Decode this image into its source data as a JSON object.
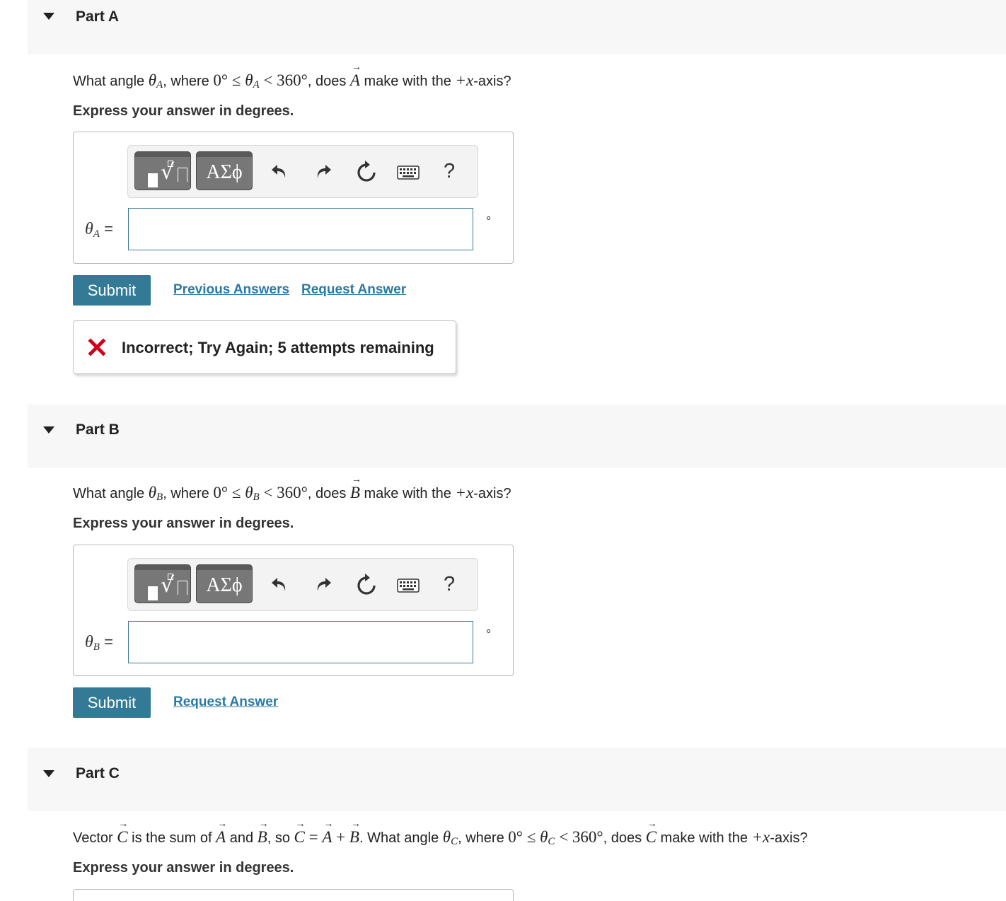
{
  "parts": [
    {
      "title": "Part A",
      "question": {
        "lead": "What angle ",
        "theta": "θ",
        "sub": "A",
        "where": ", where ",
        "range_lo": "0° ≤ ",
        "range_hi": " < 360°",
        "does": ", does ",
        "vector": "A",
        "tail": " make with the ",
        "axis": "+x",
        "axis_tail": "-axis?"
      },
      "instruction": "Express your answer in degrees.",
      "var_label": {
        "theta": "θ",
        "sub": "A",
        "eq": " ="
      },
      "input_value": "",
      "unit": "°",
      "submit_label": "Submit",
      "links": [
        "Previous Answers",
        "Request Answer"
      ],
      "feedback": "Incorrect; Try Again; 5 attempts remaining"
    },
    {
      "title": "Part B",
      "question": {
        "lead": "What angle ",
        "theta": "θ",
        "sub": "B",
        "where": ", where ",
        "range_lo": "0° ≤ ",
        "range_hi": " < 360°",
        "does": ", does ",
        "vector": "B",
        "tail": " make with the ",
        "axis": "+x",
        "axis_tail": "-axis?"
      },
      "instruction": "Express your answer in degrees.",
      "var_label": {
        "theta": "θ",
        "sub": "B",
        "eq": " ="
      },
      "input_value": "",
      "unit": "°",
      "submit_label": "Submit",
      "links": [
        "Request Answer"
      ]
    },
    {
      "title": "Part C",
      "question": {
        "p1": "Vector ",
        "C": "C",
        "p2": " is the sum of ",
        "A": "A",
        "p3": " and ",
        "B": "B",
        "p4": ", so ",
        "eq": " = ",
        "plus": " + ",
        "p5": ". What angle ",
        "theta": "θ",
        "sub": "C",
        "where": ", where ",
        "range_lo": "0° ≤ ",
        "range_hi": " < 360°",
        "does": ", does ",
        "tail": " make with the ",
        "axis": "+x",
        "axis_tail": "-axis?"
      },
      "instruction": "Express your answer in degrees."
    }
  ],
  "toolbar": {
    "templates_icon": "templates-sqrt-icon",
    "greek_label": "ΑΣϕ",
    "undo_icon": "undo-icon",
    "redo_icon": "redo-icon",
    "reset_icon": "reset-icon",
    "keyboard_icon": "keyboard-icon",
    "help_label": "?"
  },
  "colors": {
    "submit": "#337a96",
    "link": "#2b79a5",
    "error": "#d0021b",
    "input_border": "#3b7a99",
    "header_bg": "#f7f7f7"
  }
}
